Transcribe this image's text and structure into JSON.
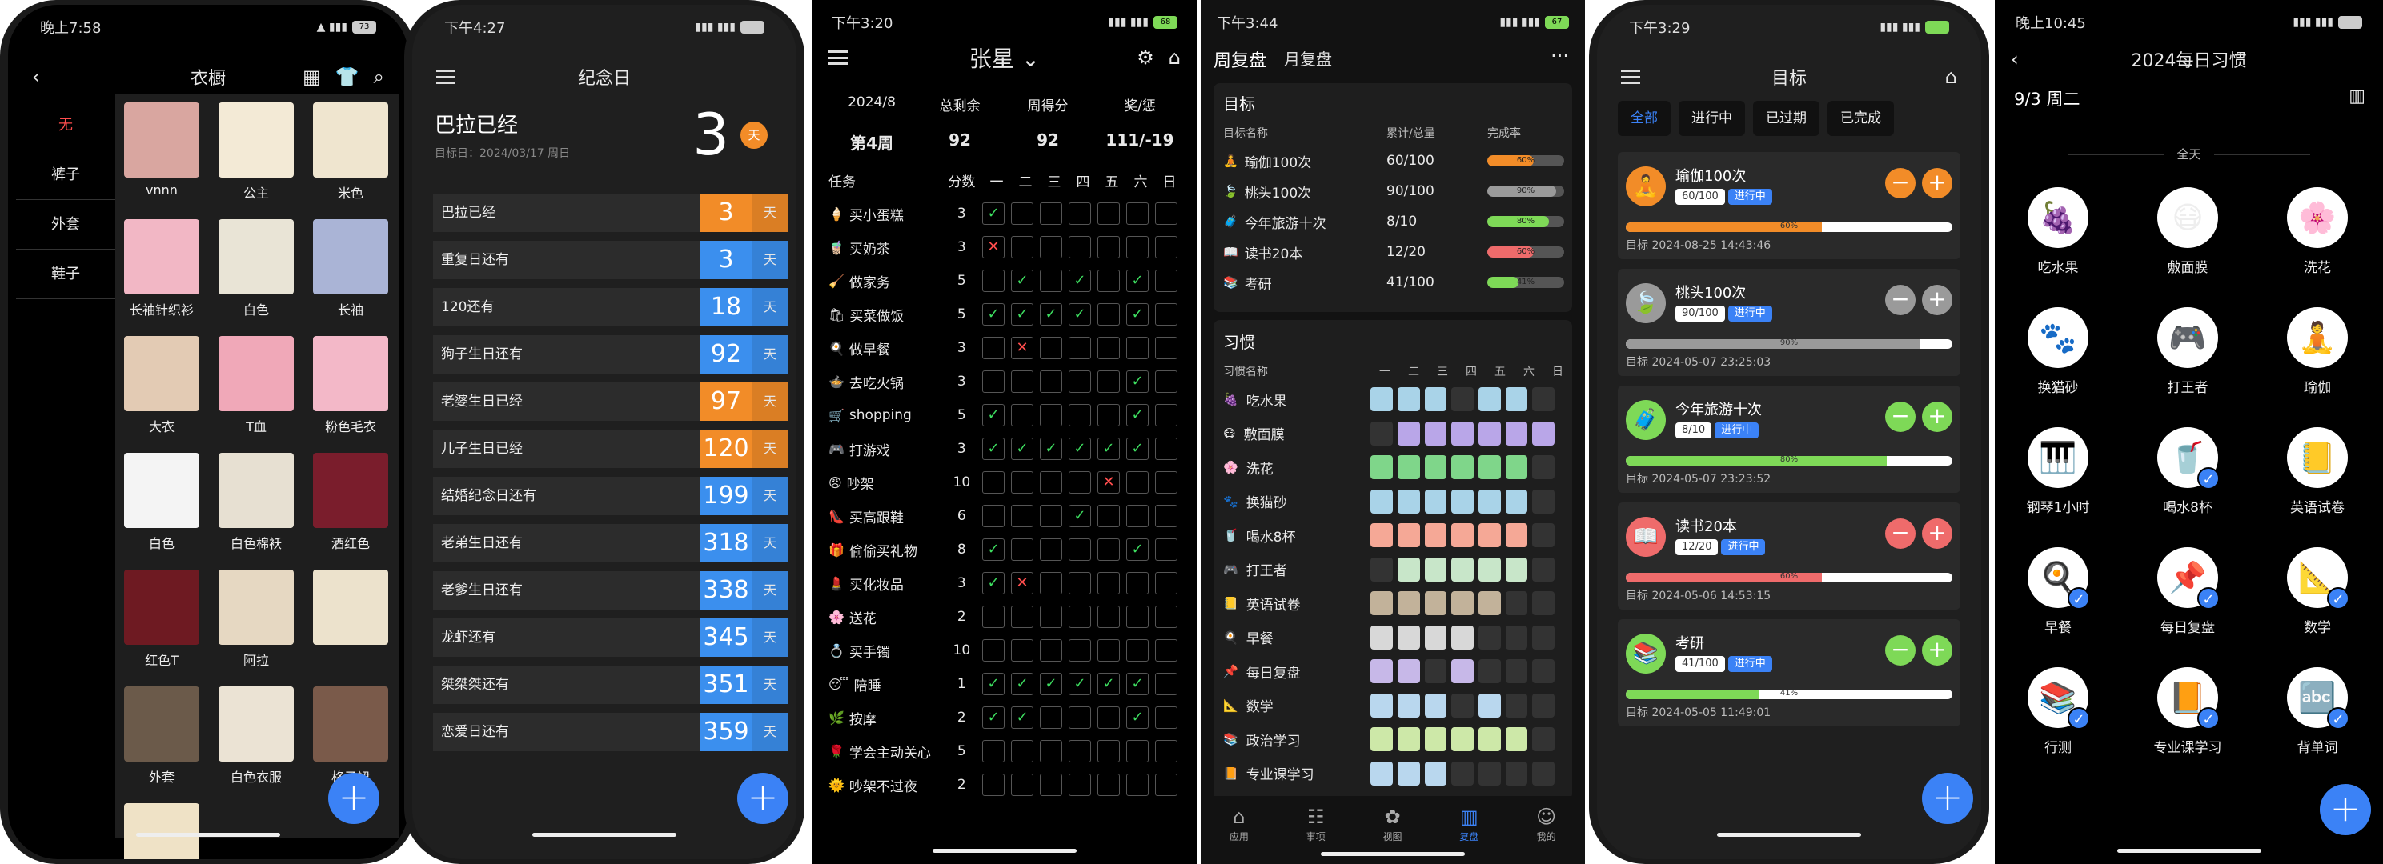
{
  "p1": {
    "time": "晚上7:58",
    "battery": "73",
    "title": "衣橱",
    "side": [
      "无",
      "裤子",
      "外套",
      "鞋子"
    ],
    "items": [
      {
        "label": "vnnn",
        "color": "#d9a6a0"
      },
      {
        "label": "公主",
        "color": "#f3ead6"
      },
      {
        "label": "米色",
        "color": "#efe5cf"
      },
      {
        "label": "长袖针织衫",
        "color": "#f2b7c5"
      },
      {
        "label": "白色",
        "color": "#e9e4d6"
      },
      {
        "label": "长袖",
        "color": "#aab4d6"
      },
      {
        "label": "大衣",
        "color": "#e3cbb4"
      },
      {
        "label": "T血",
        "color": "#f0a8b8"
      },
      {
        "label": "粉色毛衣",
        "color": "#f3b8c8"
      },
      {
        "label": "白色",
        "color": "#f4f4f4"
      },
      {
        "label": "白色棉袄",
        "color": "#e7e0d2"
      },
      {
        "label": "酒红色",
        "color": "#7a1d2c"
      },
      {
        "label": "红色T",
        "color": "#6e1a22"
      },
      {
        "label": "阿拉",
        "color": "#e6d8c2"
      },
      {
        "label": "",
        "color": "#ece2cc"
      },
      {
        "label": "外套",
        "color": "#6b5a4a"
      },
      {
        "label": "白色衣服",
        "color": "#ebe3d4"
      },
      {
        "label": "格子裙",
        "color": "#7a5a4a"
      },
      {
        "label": "",
        "color": "#efe2c6"
      }
    ],
    "fab": "+"
  },
  "p2": {
    "time": "下午4:27",
    "title": "纪念日",
    "hero": {
      "name": "巴拉已经",
      "date": "目标日：2024/03/17 周日",
      "num": "3",
      "unit": "天"
    },
    "rows": [
      {
        "name": "巴拉已经",
        "num": "3",
        "kind": "o"
      },
      {
        "name": "重复日还有",
        "num": "3",
        "kind": "b"
      },
      {
        "name": "120还有",
        "num": "18",
        "kind": "b"
      },
      {
        "name": "狗子生日还有",
        "num": "92",
        "kind": "b"
      },
      {
        "name": "老婆生日已经",
        "num": "97",
        "kind": "o"
      },
      {
        "name": "儿子生日已经",
        "num": "120",
        "kind": "o"
      },
      {
        "name": "结婚纪念日还有",
        "num": "199",
        "kind": "b"
      },
      {
        "name": "老弟生日还有",
        "num": "318",
        "kind": "b"
      },
      {
        "name": "老爹生日还有",
        "num": "338",
        "kind": "b"
      },
      {
        "name": "龙虾还有",
        "num": "345",
        "kind": "b"
      },
      {
        "name": "桀桀桀还有",
        "num": "351",
        "kind": "b"
      },
      {
        "name": "恋爱日还有",
        "num": "359",
        "kind": "b"
      }
    ],
    "unit": "天",
    "colors": {
      "o": "#f28c28",
      "b": "#3b8fee"
    }
  },
  "p3": {
    "time": "下午3:20",
    "battery": "68",
    "title": "张星",
    "stats": {
      "h1": "2024/8",
      "h2": "总剩余",
      "h3": "周得分",
      "h4": "奖/惩",
      "v1": "第4周",
      "v2": "92",
      "v3": "92",
      "v4": "111/-19"
    },
    "col_task": "任务",
    "col_score": "分数",
    "days": [
      "一",
      "二",
      "三",
      "四",
      "五",
      "六",
      "日"
    ],
    "tasks": [
      {
        "name": "买小蛋糕",
        "score": "3",
        "icon": "🍦",
        "marks": "v......"
      },
      {
        "name": "买奶茶",
        "score": "3",
        "icon": "🧋",
        "marks": "x......"
      },
      {
        "name": "做家务",
        "score": "5",
        "icon": "🧹",
        "marks": ".v.v.v."
      },
      {
        "name": "买菜做饭",
        "score": "5",
        "icon": "🛍",
        "marks": "vvvv.v."
      },
      {
        "name": "做早餐",
        "score": "3",
        "icon": "🍳",
        "marks": ".x....."
      },
      {
        "name": "去吃火锅",
        "score": "3",
        "icon": "🍲",
        "marks": ".....v."
      },
      {
        "name": "shopping",
        "score": "5",
        "icon": "🛒",
        "marks": "v....v."
      },
      {
        "name": "打游戏",
        "score": "3",
        "icon": "🎮",
        "marks": "vvvvvv."
      },
      {
        "name": "吵架",
        "score": "10",
        "icon": "😠",
        "marks": "....x.."
      },
      {
        "name": "买高跟鞋",
        "score": "6",
        "icon": "👠",
        "marks": "...v..."
      },
      {
        "name": "偷偷买礼物",
        "score": "8",
        "icon": "🎁",
        "marks": "v....v."
      },
      {
        "name": "买化妆品",
        "score": "3",
        "icon": "💄",
        "marks": "vx....."
      },
      {
        "name": "送花",
        "score": "2",
        "icon": "🌸",
        "marks": "......."
      },
      {
        "name": "买手镯",
        "score": "10",
        "icon": "💍",
        "marks": "......."
      },
      {
        "name": "陪睡",
        "score": "1",
        "icon": "😴",
        "marks": "vvvvvv."
      },
      {
        "name": "按摩",
        "score": "2",
        "icon": "🌿",
        "marks": "vv...v."
      },
      {
        "name": "学会主动关心",
        "score": "5",
        "icon": "🌹",
        "marks": "......."
      },
      {
        "name": "吵架不过夜",
        "score": "2",
        "icon": "🌞",
        "marks": "......."
      }
    ]
  },
  "p4": {
    "time": "下午3:44",
    "battery": "67",
    "tab1": "周复盘",
    "tab2": "月复盘",
    "more": "···",
    "goal_title": "目标",
    "goal_cols": [
      "目标名称",
      "累计/总量",
      "完成率"
    ],
    "goals": [
      {
        "name": "瑜伽100次",
        "val": "60/100",
        "pct": 60,
        "pct_label": "60%",
        "color": "#f28c28",
        "icon": "🧘"
      },
      {
        "name": "桃头100次",
        "val": "90/100",
        "pct": 90,
        "pct_label": "90%",
        "color": "#9a9a9a",
        "icon": "🍃"
      },
      {
        "name": "今年旅游十次",
        "val": "8/10",
        "pct": 80,
        "pct_label": "80%",
        "color": "#7ed957",
        "icon": "🧳"
      },
      {
        "name": "读书20本",
        "val": "12/20",
        "pct": 60,
        "pct_label": "60%",
        "color": "#ef6b6b",
        "icon": "📖"
      },
      {
        "name": "考研",
        "val": "41/100",
        "pct": 41,
        "pct_label": "41%",
        "color": "#7ed957",
        "icon": "📚"
      }
    ],
    "habit_title": "习惯",
    "habit_col": "习惯名称",
    "days": [
      "一",
      "二",
      "三",
      "四",
      "五",
      "六",
      "日"
    ],
    "habits": [
      {
        "name": "吃水果",
        "icon": "🍇",
        "color": "#a9d3e8",
        "on": "1110110"
      },
      {
        "name": "敷面膜",
        "icon": "😷",
        "color": "#b9a6e8",
        "on": "0111111"
      },
      {
        "name": "洗花",
        "icon": "🌸",
        "color": "#7fd68a",
        "on": "1111110"
      },
      {
        "name": "换猫砂",
        "icon": "🐾",
        "color": "#a9d3e8",
        "on": "1111110"
      },
      {
        "name": "喝水8杯",
        "icon": "🥤",
        "color": "#f5a896",
        "on": "1111110"
      },
      {
        "name": "打王者",
        "icon": "🎮",
        "color": "#c8e6c9",
        "on": "0111110"
      },
      {
        "name": "英语试卷",
        "icon": "📒",
        "color": "#c2b29a",
        "on": "1111100"
      },
      {
        "name": "早餐",
        "icon": "🍳",
        "color": "#d8d8d8",
        "on": "1111000"
      },
      {
        "name": "每日复盘",
        "icon": "📌",
        "color": "#c7b8e8",
        "on": "1101000"
      },
      {
        "name": "数学",
        "icon": "📐",
        "color": "#b9d7ee",
        "on": "1110100"
      },
      {
        "name": "政治学习",
        "icon": "📚",
        "color": "#cde8a8",
        "on": "1111110"
      },
      {
        "name": "专业课学习",
        "icon": "📙",
        "color": "#b9d7ee",
        "on": "1110000"
      }
    ],
    "nav": [
      {
        "g": "⌂",
        "t": "应用"
      },
      {
        "g": "☷",
        "t": "事项"
      },
      {
        "g": "✿",
        "t": "视图"
      },
      {
        "g": "▥",
        "t": "复盘"
      },
      {
        "g": "☺",
        "t": "我的"
      }
    ]
  },
  "p5": {
    "time": "下午3:29",
    "title": "目标",
    "filters": [
      "全部",
      "进行中",
      "已过期",
      "已完成"
    ],
    "goals": [
      {
        "name": "瑜伽100次",
        "cnt": "60/100",
        "status": "进行中",
        "pct": 60,
        "pct_label": "60%",
        "date": "目标 2024-08-25 14:43:46",
        "color": "#f28c28",
        "icon": "🧘"
      },
      {
        "name": "桃头100次",
        "cnt": "90/100",
        "status": "进行中",
        "pct": 90,
        "pct_label": "90%",
        "date": "目标 2024-05-07 23:25:03",
        "color": "#9a9a9a",
        "icon": "🍃"
      },
      {
        "name": "今年旅游十次",
        "cnt": "8/10",
        "status": "进行中",
        "pct": 80,
        "pct_label": "80%",
        "date": "目标 2024-05-07 23:23:52",
        "color": "#7ed957",
        "icon": "🧳"
      },
      {
        "name": "读书20本",
        "cnt": "12/20",
        "status": "进行中",
        "pct": 60,
        "pct_label": "60%",
        "date": "目标 2024-05-06 14:53:15",
        "color": "#ef6b6b",
        "icon": "📖"
      },
      {
        "name": "考研",
        "cnt": "41/100",
        "status": "进行中",
        "pct": 41,
        "pct_label": "41%",
        "date": "目标 2024-05-05 11:49:01",
        "color": "#7ed957",
        "icon": "📚"
      }
    ]
  },
  "p6": {
    "time": "晚上10:45",
    "title": "2024每日习惯",
    "date": "9/3 周二",
    "allday": "全天",
    "habits": [
      {
        "name": "吃水果",
        "icon": "🍇",
        "done": false
      },
      {
        "name": "敷面膜",
        "icon": "😷",
        "done": false
      },
      {
        "name": "洗花",
        "icon": "🌸",
        "done": false
      },
      {
        "name": "换猫砂",
        "icon": "🐾",
        "done": false
      },
      {
        "name": "打王者",
        "icon": "🎮",
        "done": false
      },
      {
        "name": "瑜伽",
        "icon": "🧘",
        "done": false
      },
      {
        "name": "钢琴1小时",
        "icon": "🎹",
        "done": false
      },
      {
        "name": "喝水8杯",
        "icon": "🥤",
        "done": true
      },
      {
        "name": "英语试卷",
        "icon": "📒",
        "done": false
      },
      {
        "name": "早餐",
        "icon": "🍳",
        "done": true
      },
      {
        "name": "每日复盘",
        "icon": "📌",
        "done": true
      },
      {
        "name": "数学",
        "icon": "📐",
        "done": true
      },
      {
        "name": "行测",
        "icon": "📚",
        "done": true
      },
      {
        "name": "专业课学习",
        "icon": "📙",
        "done": true
      },
      {
        "name": "背单词",
        "icon": "🔤",
        "done": true
      }
    ]
  }
}
